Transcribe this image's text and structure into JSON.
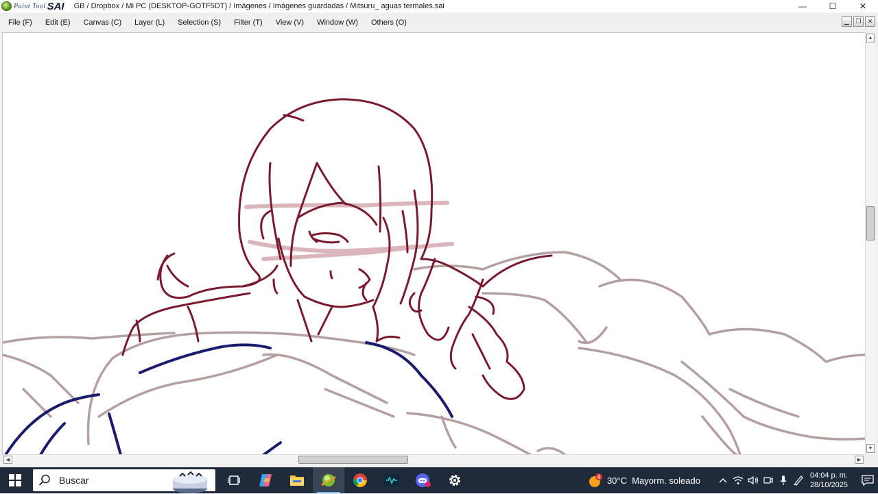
{
  "window": {
    "app_logo_paint": "Paint Tool",
    "app_logo_sai": "SAI",
    "title": "GB / Dropbox / Mi PC (DESKTOP-GOTF5DT) / Imágenes / Imágenes guardadas / Mitsuru_ aguas termales.sai",
    "minimize_glyph": "—",
    "maximize_glyph": "☐",
    "close_glyph": "✕"
  },
  "menu": {
    "items": [
      {
        "label": "File (F)"
      },
      {
        "label": "Edit (E)"
      },
      {
        "label": "Canvas (C)"
      },
      {
        "label": "Layer (L)"
      },
      {
        "label": "Selection (S)"
      },
      {
        "label": "Filter (T)"
      },
      {
        "label": "View (V)"
      },
      {
        "label": "Window (W)"
      },
      {
        "label": "Others (O)"
      }
    ],
    "mdi_minimize": "▁",
    "mdi_restore": "❐",
    "mdi_close": "✕"
  },
  "canvas": {
    "sketch_colors": {
      "face": "#7a1a2e",
      "pink": "#d4a9b1",
      "blue": "#1a1a6e",
      "grey": "#a89090"
    }
  },
  "scrollbars": {
    "up": "▲",
    "down": "▼",
    "left": "◀",
    "right": "▶"
  },
  "taskbar": {
    "search_placeholder": "Buscar",
    "apps": [
      {
        "name": "task-view"
      },
      {
        "name": "copilot"
      },
      {
        "name": "file-explorer"
      },
      {
        "name": "painttool-sai",
        "active": true
      },
      {
        "name": "chrome"
      },
      {
        "name": "audio-app"
      },
      {
        "name": "discord"
      },
      {
        "name": "settings"
      }
    ],
    "weather_badge": "4",
    "temperature": "30°C",
    "weather": "Mayorm. soleado",
    "time": "04:04 p. m.",
    "date": "28/10/2025"
  }
}
